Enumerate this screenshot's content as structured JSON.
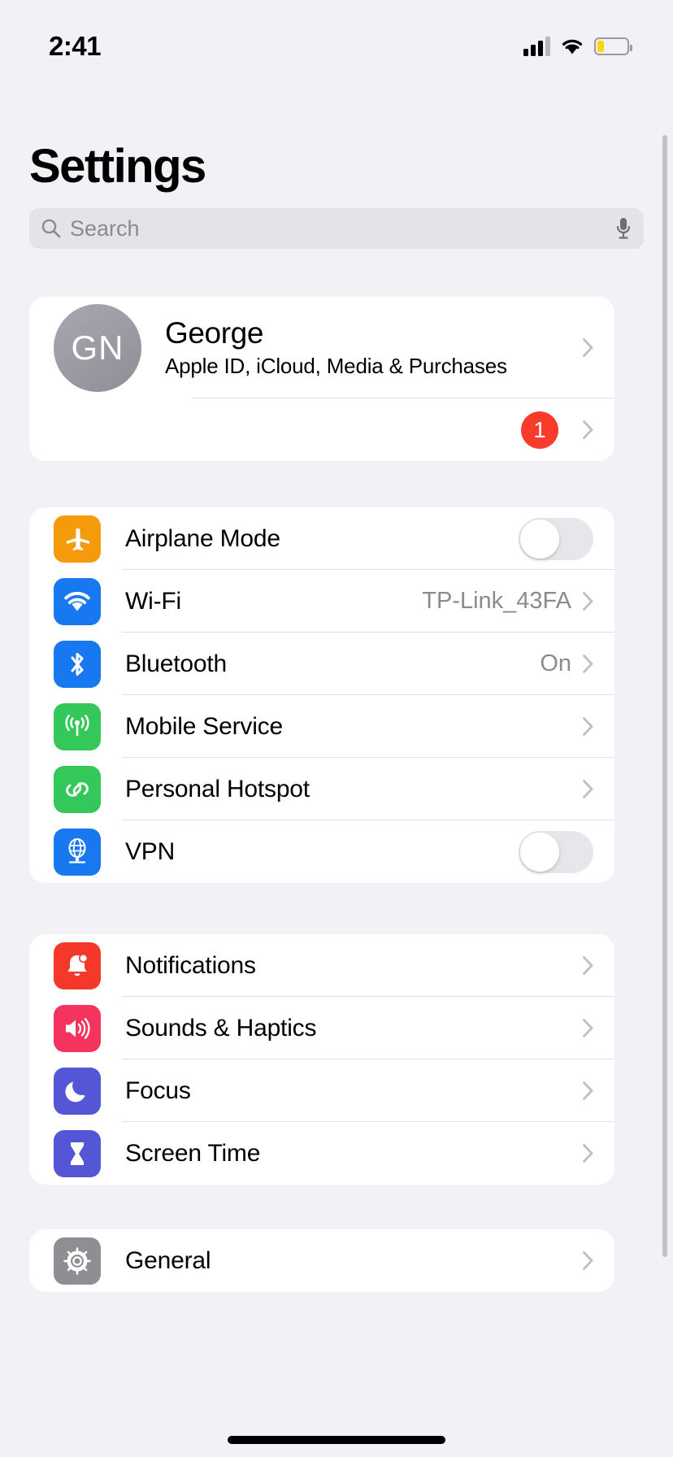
{
  "status_bar": {
    "time": "2:41",
    "cellular_icon": "cellular-signal-icon",
    "cellular_bars": 3,
    "wifi_icon": "wifi-icon",
    "battery_icon": "battery-low-icon",
    "battery_level_percent": 22,
    "battery_color": "#ffd60a"
  },
  "header": {
    "title": "Settings"
  },
  "search": {
    "placeholder": "Search",
    "value": "",
    "search_icon": "search-icon",
    "mic_icon": "microphone-icon"
  },
  "profile": {
    "initials": "GN",
    "name": "George",
    "subtitle": "Apple ID, iCloud, Media & Purchases",
    "chevron_icon": "chevron-right-icon",
    "badge": {
      "count": "1",
      "color": "#f93b2b",
      "chevron_icon": "chevron-right-icon"
    }
  },
  "groups": [
    {
      "id": "connectivity",
      "rows": [
        {
          "label": "Airplane Mode",
          "icon": "airplane-icon",
          "icon_color": "#f59a0b",
          "accessory": "toggle",
          "toggle_on": false
        },
        {
          "label": "Wi-Fi",
          "icon": "wifi-icon",
          "icon_color": "#1878f0",
          "accessory": "value",
          "value": "TP-Link_43FA"
        },
        {
          "label": "Bluetooth",
          "icon": "bluetooth-icon",
          "icon_color": "#1878f0",
          "accessory": "value",
          "value": "On"
        },
        {
          "label": "Mobile Service",
          "icon": "mobile-signal-icon",
          "icon_color": "#34c759",
          "accessory": "chevron",
          "value": ""
        },
        {
          "label": "Personal Hotspot",
          "icon": "hotspot-link-icon",
          "icon_color": "#34c759",
          "accessory": "chevron",
          "value": ""
        },
        {
          "label": "VPN",
          "icon": "vpn-globe-icon",
          "icon_color": "#1878f0",
          "accessory": "toggle",
          "toggle_on": false
        }
      ]
    },
    {
      "id": "notifications",
      "rows": [
        {
          "label": "Notifications",
          "icon": "bell-badge-icon",
          "icon_color": "#f4392b",
          "accessory": "chevron",
          "value": ""
        },
        {
          "label": "Sounds & Haptics",
          "icon": "speaker-waves-icon",
          "icon_color": "#f4335f",
          "accessory": "chevron",
          "value": ""
        },
        {
          "label": "Focus",
          "icon": "moon-icon",
          "icon_color": "#5456d6",
          "accessory": "chevron",
          "value": ""
        },
        {
          "label": "Screen Time",
          "icon": "hourglass-icon",
          "icon_color": "#5456d6",
          "accessory": "chevron",
          "value": ""
        }
      ]
    },
    {
      "id": "general",
      "rows": [
        {
          "label": "General",
          "icon": "gear-icon",
          "icon_color": "#8e8e93",
          "accessory": "chevron",
          "value": ""
        }
      ]
    }
  ]
}
